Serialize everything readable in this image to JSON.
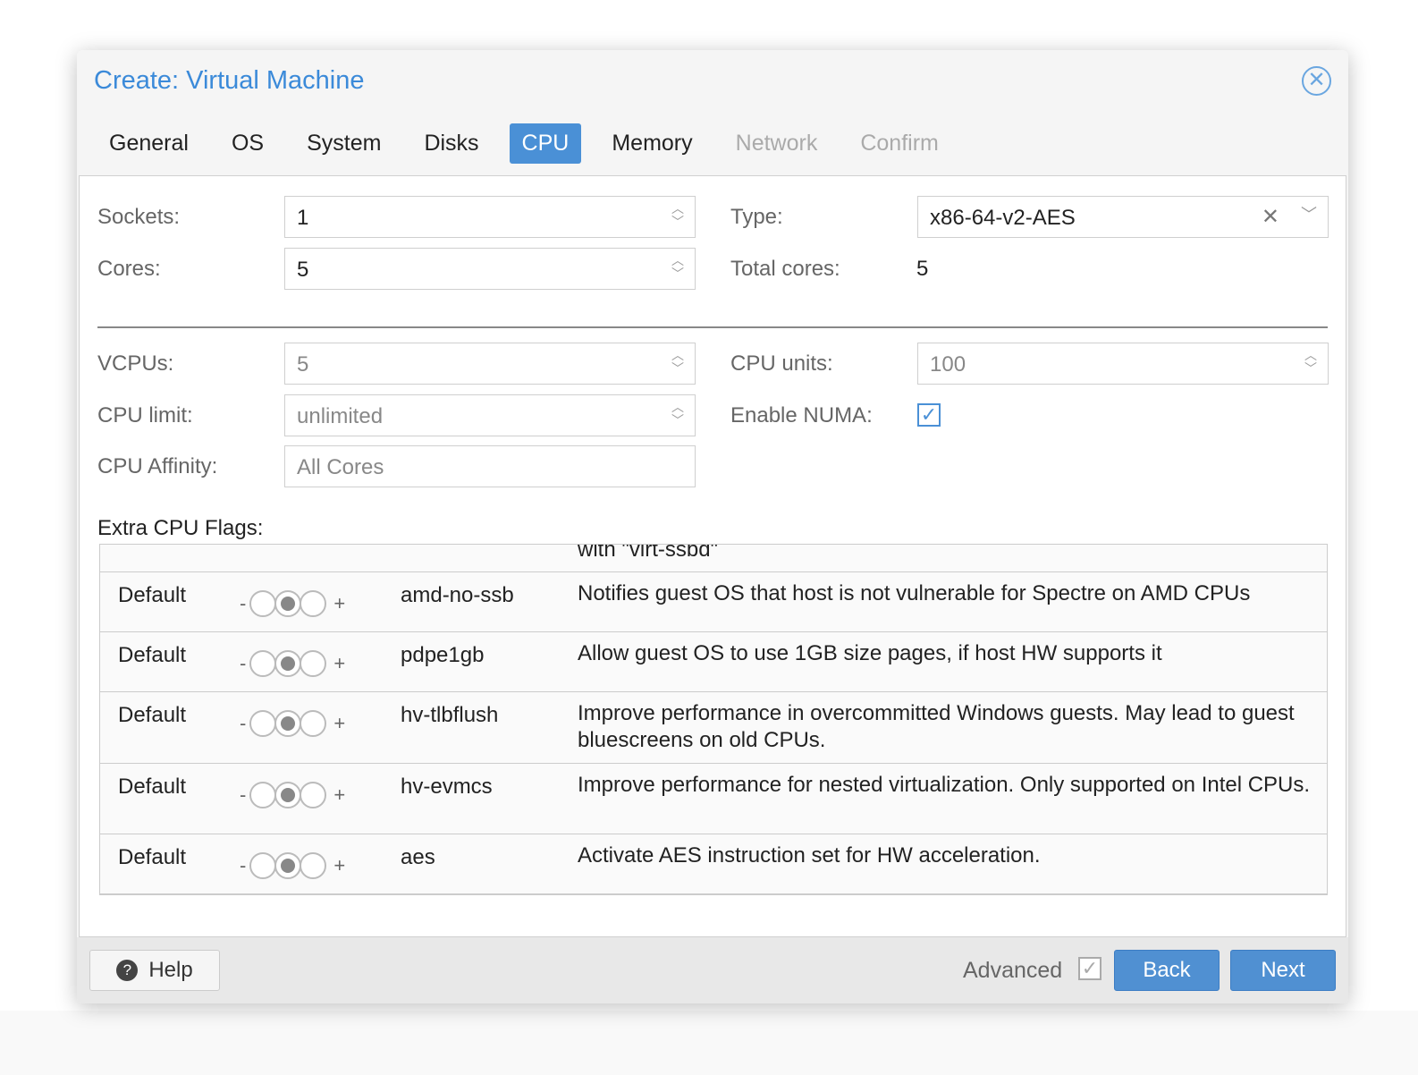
{
  "dialog": {
    "title": "Create: Virtual Machine"
  },
  "tabs": [
    {
      "label": "General",
      "state": "normal"
    },
    {
      "label": "OS",
      "state": "normal"
    },
    {
      "label": "System",
      "state": "normal"
    },
    {
      "label": "Disks",
      "state": "normal"
    },
    {
      "label": "CPU",
      "state": "active"
    },
    {
      "label": "Memory",
      "state": "normal"
    },
    {
      "label": "Network",
      "state": "disabled"
    },
    {
      "label": "Confirm",
      "state": "disabled"
    }
  ],
  "form": {
    "sockets": {
      "label": "Sockets:",
      "value": "1"
    },
    "cores": {
      "label": "Cores:",
      "value": "5"
    },
    "type": {
      "label": "Type:",
      "value": "x86-64-v2-AES"
    },
    "total_cores": {
      "label": "Total cores:",
      "value": "5"
    },
    "vcpus": {
      "label": "VCPUs:",
      "value": "5"
    },
    "cpu_units": {
      "label": "CPU units:",
      "value": "100"
    },
    "cpu_limit": {
      "label": "CPU limit:",
      "value": "unlimited"
    },
    "numa": {
      "label": "Enable NUMA:",
      "checked": true
    },
    "affinity": {
      "label": "CPU Affinity:",
      "placeholder": "All Cores"
    },
    "flags_label": "Extra CPU Flags:"
  },
  "flags": {
    "partial_desc": "with \"virt-ssbd\"",
    "rows": [
      {
        "state": "Default",
        "name": "amd-no-ssb",
        "desc": "Notifies guest OS that host is not vulnerable for Spectre on AMD CPUs"
      },
      {
        "state": "Default",
        "name": "pdpe1gb",
        "desc": "Allow guest OS to use 1GB size pages, if host HW supports it"
      },
      {
        "state": "Default",
        "name": "hv-tlbflush",
        "desc": "Improve performance in overcommitted Windows guests. May lead to guest bluescreens on old CPUs."
      },
      {
        "state": "Default",
        "name": "hv-evmcs",
        "desc": "Improve performance for nested virtualization. Only supported on Intel CPUs."
      },
      {
        "state": "Default",
        "name": "aes",
        "desc": "Activate AES instruction set for HW acceleration."
      }
    ]
  },
  "footer": {
    "help": "Help",
    "advanced": "Advanced",
    "advanced_checked": true,
    "back": "Back",
    "next": "Next"
  },
  "colors": {
    "accent": "#4a90d6",
    "title": "#3b8ad9"
  }
}
